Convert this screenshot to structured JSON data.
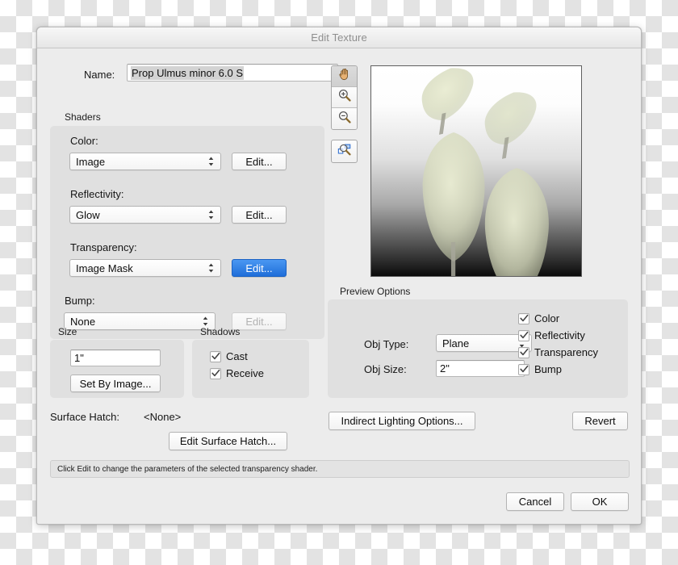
{
  "window": {
    "title": "Edit Texture"
  },
  "name_row": {
    "label": "Name:",
    "value": "Prop Ulmus minor 6.0 S"
  },
  "shaders": {
    "group_label": "Shaders",
    "rows": [
      {
        "label": "Color:",
        "value": "Image",
        "edit_label": "Edit...",
        "edit_state": "normal"
      },
      {
        "label": "Reflectivity:",
        "value": "Glow",
        "edit_label": "Edit...",
        "edit_state": "normal"
      },
      {
        "label": "Transparency:",
        "value": "Image Mask",
        "edit_label": "Edit...",
        "edit_state": "primary"
      },
      {
        "label": "Bump:",
        "value": "None",
        "edit_label": "Edit...",
        "edit_state": "disabled"
      }
    ]
  },
  "size": {
    "group_label": "Size",
    "value": "1\"",
    "set_by_image_label": "Set By Image..."
  },
  "shadows": {
    "group_label": "Shadows",
    "items": [
      {
        "label": "Cast",
        "checked": true
      },
      {
        "label": "Receive",
        "checked": true
      }
    ]
  },
  "surface_hatch": {
    "label": "Surface Hatch:",
    "value": "<None>",
    "edit_label": "Edit Surface Hatch..."
  },
  "status": {
    "text": "Click Edit to change the parameters of the selected transparency shader."
  },
  "toolbar": {
    "tools": [
      {
        "name": "pan-hand-tool",
        "icon": "hand-icon",
        "selected": true
      },
      {
        "name": "zoom-in-tool",
        "icon": "magnifier-plus-icon",
        "selected": false
      },
      {
        "name": "zoom-out-tool",
        "icon": "magnifier-minus-icon",
        "selected": false
      }
    ],
    "zoom_selection": {
      "name": "zoom-to-selection-tool",
      "icon": "magnifier-marquee-icon"
    }
  },
  "preview_options": {
    "group_label": "Preview Options",
    "obj_type_label": "Obj Type:",
    "obj_type_value": "Plane",
    "obj_size_label": "Obj Size:",
    "obj_size_value": "2\"",
    "channels": [
      {
        "label": "Color",
        "checked": true
      },
      {
        "label": "Reflectivity",
        "checked": true
      },
      {
        "label": "Transparency",
        "checked": true
      },
      {
        "label": "Bump",
        "checked": true
      }
    ]
  },
  "actions": {
    "indirect_lighting": "Indirect Lighting Options...",
    "revert": "Revert",
    "cancel": "Cancel",
    "ok": "OK"
  },
  "colors": {
    "dialog_bg": "#ececec",
    "group_bg": "#e0e0e0",
    "accent_blue": "#2f7fe4",
    "title_text": "#8e8e8e",
    "selection": "#d3d3d3"
  }
}
